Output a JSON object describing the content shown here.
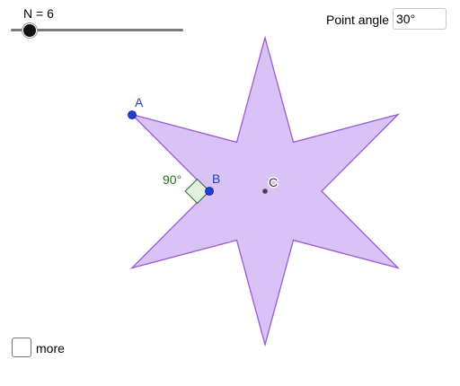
{
  "slider": {
    "label": "N = 6",
    "value": 6,
    "min": 3,
    "max": 30
  },
  "point_angle": {
    "label": "Point angle",
    "value": "30°"
  },
  "figure": {
    "points": {
      "a": "A",
      "b": "B",
      "c": "C"
    },
    "right_angle_label": "90°",
    "colors": {
      "star_fill": "#d9c2f5",
      "star_stroke": "#9b59d6",
      "point": "#1f3fd6",
      "point_label": "#1f3fd6",
      "angle_marker_fill": "#e2f0e0",
      "angle_marker_stroke": "#2e6b2e",
      "angle_label": "#2e6b2e",
      "center_point": "#444444"
    }
  },
  "more": {
    "label": "more",
    "checked": false
  }
}
